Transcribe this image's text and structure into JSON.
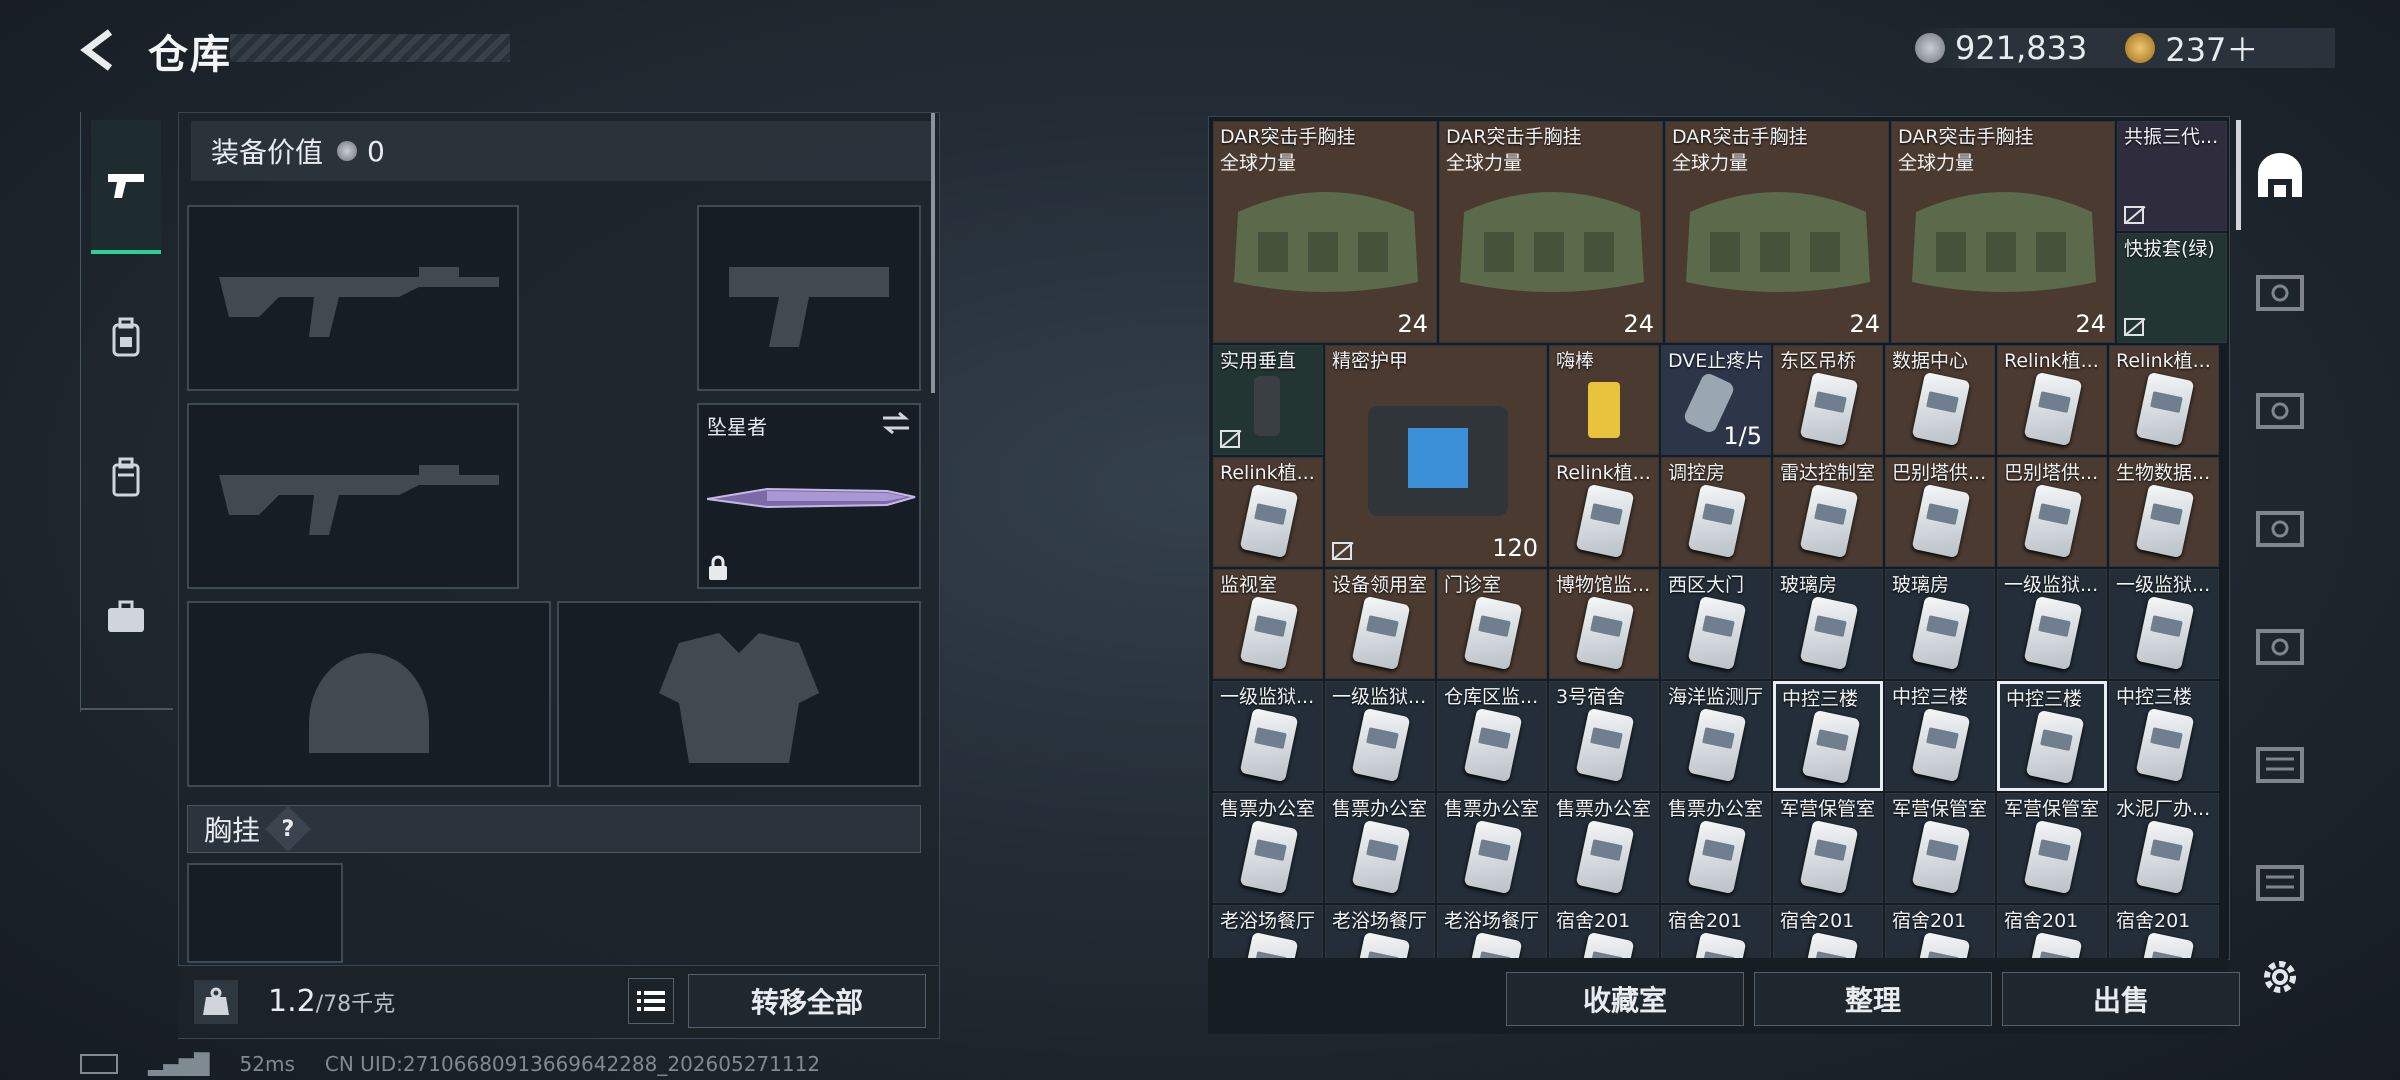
{
  "header": {
    "title": "仓库"
  },
  "currency": {
    "coins": "921,833",
    "bonds": "237＋"
  },
  "loadout": {
    "value_label": "装备价值",
    "value": "0",
    "melee_name": "坠星者",
    "chest_label": "胸挂",
    "help": "?",
    "weight": "1.2",
    "weight_max": "/78千克",
    "transfer_all": "转移全部"
  },
  "inventory": {
    "row0": [
      {
        "n1": "DAR突击手胸挂",
        "n2": "全球力量",
        "count": "24"
      },
      {
        "n1": "DAR突击手胸挂",
        "n2": "全球力量",
        "count": "24"
      },
      {
        "n1": "DAR突击手胸挂",
        "n2": "全球力量",
        "count": "24"
      },
      {
        "n1": "DAR突击手胸挂",
        "n2": "全球力量",
        "count": "24"
      }
    ],
    "side0": "共振三代...",
    "side1": "快拔套(绿)",
    "row1": [
      "实用垂直",
      "精密护甲",
      "嗨棒",
      "DVE止疼片",
      "东区吊桥",
      "数据中心",
      "Relink植...",
      "Relink植..."
    ],
    "dve_count": "1/5",
    "armor_durability": "120",
    "row2": [
      "Relink植...",
      "Relink植...",
      "调控房",
      "雷达控制室",
      "巴别塔供...",
      "巴别塔供...",
      "生物数据..."
    ],
    "row3": [
      "监视室",
      "设备领用室",
      "门诊室",
      "博物馆监...",
      "西区大门",
      "玻璃房",
      "玻璃房",
      "一级监狱...",
      "一级监狱..."
    ],
    "row4": [
      "一级监狱...",
      "一级监狱...",
      "仓库区监...",
      "3号宿舍",
      "海洋监测厅",
      "中控三楼",
      "中控三楼",
      "中控三楼",
      "中控三楼"
    ],
    "row5": [
      "售票办公室",
      "售票办公室",
      "售票办公室",
      "售票办公室",
      "售票办公室",
      "军营保管室",
      "军营保管室",
      "军营保管室",
      "水泥厂办..."
    ],
    "row6": [
      "老浴场餐厅",
      "老浴场餐厅",
      "老浴场餐厅",
      "宿舍201",
      "宿舍201",
      "宿舍201",
      "宿舍201",
      "宿舍201",
      "宿舍201"
    ]
  },
  "actions": {
    "collection": "收藏室",
    "sort": "整理",
    "sell": "出售"
  },
  "status": {
    "ping": "52ms",
    "uid": "CN UID:27106680913669642288_202605271112"
  },
  "colors": {
    "accent": "#2ecf96",
    "cell_bg": "#232e38",
    "stack_bg": "#4a3a30"
  }
}
